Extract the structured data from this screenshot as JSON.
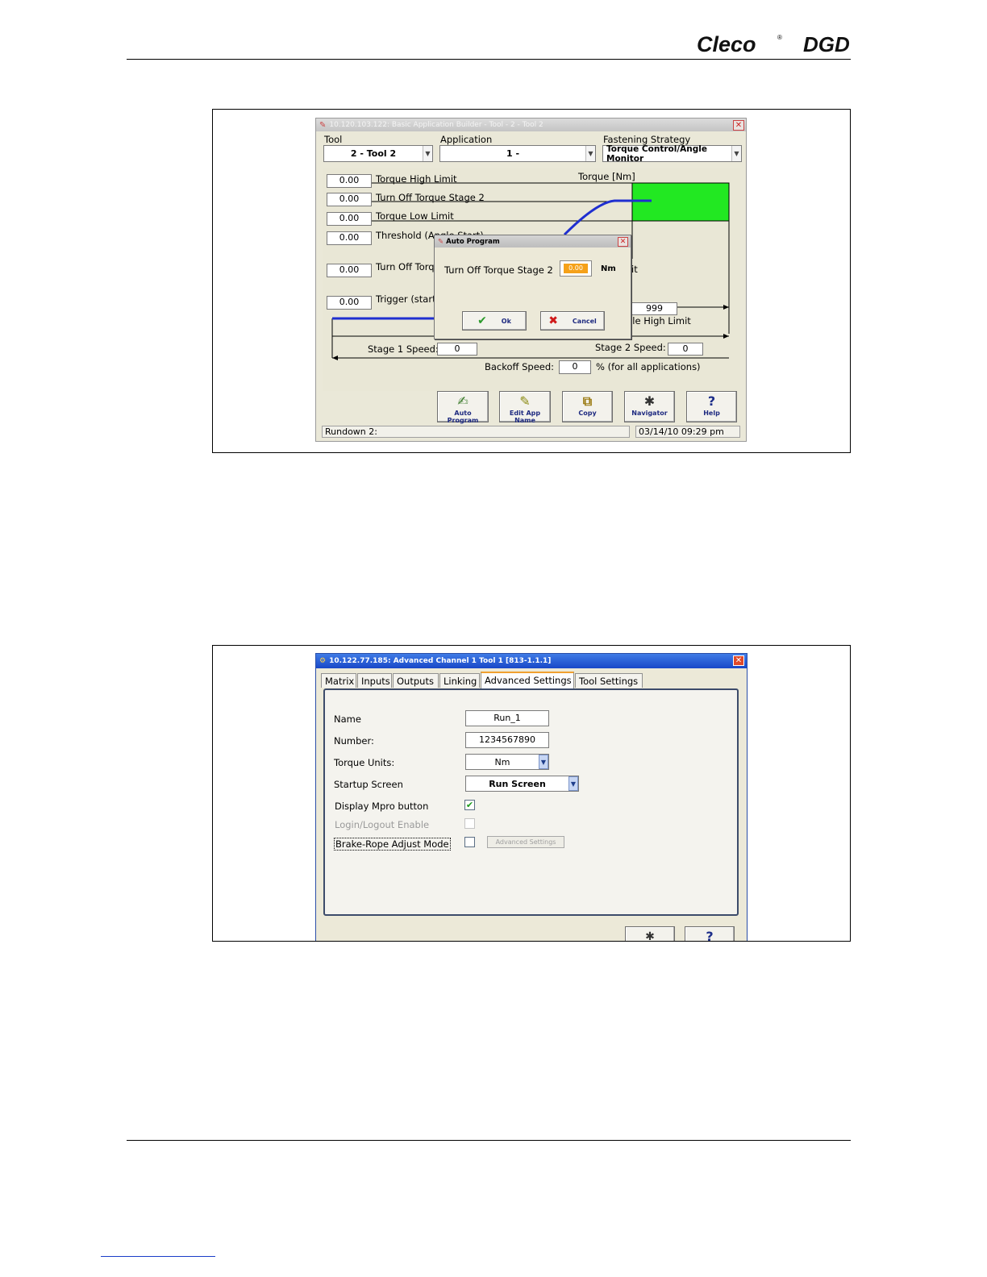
{
  "header": {
    "logo_primary": "Cleco",
    "logo_secondary": "DGD",
    "registered_mark": "®"
  },
  "figure1": {
    "window_title": "10.120.103.122: Basic Application Builder - Tool - 2 - Tool 2",
    "tool_label": "Tool",
    "tool_value": "2 - Tool 2",
    "application_label": "Application",
    "application_value": "1 -",
    "strategy_label": "Fastening Strategy",
    "strategy_value": "Torque Control/Angle Monitor",
    "torque_axis_label": "Torque [Nm]",
    "fields": [
      {
        "value": "0.00",
        "label": "Torque High Limit"
      },
      {
        "value": "0.00",
        "label": "Turn Off Torque Stage 2"
      },
      {
        "value": "0.00",
        "label": "Torque Low Limit"
      },
      {
        "value": "0.00",
        "label": "Threshold (Angle Start)"
      },
      {
        "value": "0.00",
        "label": "Turn Off Torque"
      },
      {
        "value": "0.00",
        "label": "Trigger (start"
      }
    ],
    "limit_fragment": "it",
    "angle_high_value": "999",
    "angle_high_label": "gle  High Limit",
    "stage1_speed_label": "Stage 1 Speed:",
    "stage1_speed_value": "0",
    "stage2_speed_label": "Stage 2 Speed:",
    "stage2_speed_value": "0",
    "backoff_label": "Backoff Speed:",
    "backoff_value": "0",
    "backoff_suffix": "%  (for all applications)",
    "toolbar": [
      {
        "label": "Auto Program",
        "icon": "auto-program-icon",
        "glyph": "✍"
      },
      {
        "label": "Edit App Name",
        "icon": "pencil-icon",
        "glyph": "✎"
      },
      {
        "label": "Copy",
        "icon": "copy-icon",
        "glyph": "⧉"
      },
      {
        "label": "Navigator",
        "icon": "navigator-icon",
        "glyph": "✱"
      },
      {
        "label": "Help",
        "icon": "help-icon",
        "glyph": "?"
      }
    ],
    "status_left": "Rundown 2:",
    "status_right": "03/14/10 09:29 pm",
    "dialog": {
      "title": "Auto Program",
      "field_label": "Turn Off Torque Stage 2",
      "field_value": "0.00",
      "unit": "Nm",
      "ok_label": "Ok",
      "cancel_label": "Cancel"
    },
    "colors": {
      "target_zone": "#22e822",
      "curve": "#1f2fd0",
      "title_bar": "#c8c8c8"
    }
  },
  "figure2": {
    "window_title": "10.122.77.185: Advanced Channel 1  Tool 1 [813-1.1.1]",
    "tabs": [
      "Matrix",
      "Inputs",
      "Outputs",
      "Linking",
      "Advanced Settings",
      "Tool Settings"
    ],
    "active_tab": "Advanced Settings",
    "name_label": "Name",
    "name_value": "Run_1",
    "number_label": "Number:",
    "number_value": "1234567890",
    "torque_units_label": "Torque Units:",
    "torque_units_value": "Nm",
    "startup_label": "Startup Screen",
    "startup_value": "Run Screen",
    "mpro_label": "Display Mpro button",
    "mpro_checked": true,
    "login_label": "Login/Logout Enable",
    "login_checked": false,
    "brake_label": "Brake-Rope Adjust Mode",
    "brake_checked": false,
    "adv_button_label": "Advanced Settings",
    "colors": {
      "title_bar": "#1c4fd8"
    }
  }
}
